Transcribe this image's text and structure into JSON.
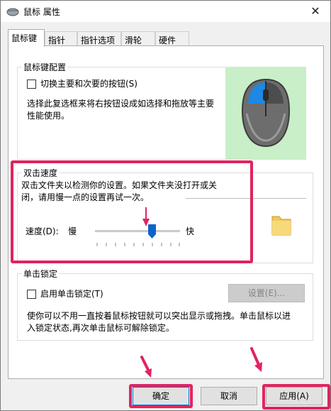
{
  "window": {
    "title": "鼠标 属性",
    "close_glyph": "✕"
  },
  "tabs": [
    {
      "label": "鼠标键",
      "active": true
    },
    {
      "label": "指针",
      "active": false
    },
    {
      "label": "指针选项",
      "active": false
    },
    {
      "label": "滑轮",
      "active": false
    },
    {
      "label": "硬件",
      "active": false
    }
  ],
  "button_config": {
    "group_title": "鼠标键配置",
    "checkbox_label": "切换主要和次要的按钮(S)",
    "checked": false,
    "description_line1": "选择此复选框来将右按钮设成如选择和拖放等主要",
    "description_line2": "性能使用。"
  },
  "double_click": {
    "group_title": "双击速度",
    "description_line1": "双击文件夹以检测你的设置。如果文件夹没打开或关",
    "description_line2": "闭，请用慢一点的设置再试一次。",
    "speed_label": "速度(D):",
    "slow_label": "慢",
    "fast_label": "快",
    "slider_value_percent": 67
  },
  "click_lock": {
    "group_title": "单击锁定",
    "checkbox_label": "启用单击锁定(T)",
    "checked": false,
    "settings_button": "设置(E)...",
    "description_line1": "使你可以不用一直按着鼠标按钮就可以突出显示或拖拽。单击鼠标以进",
    "description_line2": "入锁定状态,再次单击鼠标可解除锁定。"
  },
  "footer": {
    "ok": "确定",
    "cancel": "取消",
    "apply": "应用(A)"
  },
  "colors": {
    "highlight": "#e0245e",
    "mouse_panel_bg": "#c8efc8",
    "mouse_accent": "#1e88e5"
  }
}
